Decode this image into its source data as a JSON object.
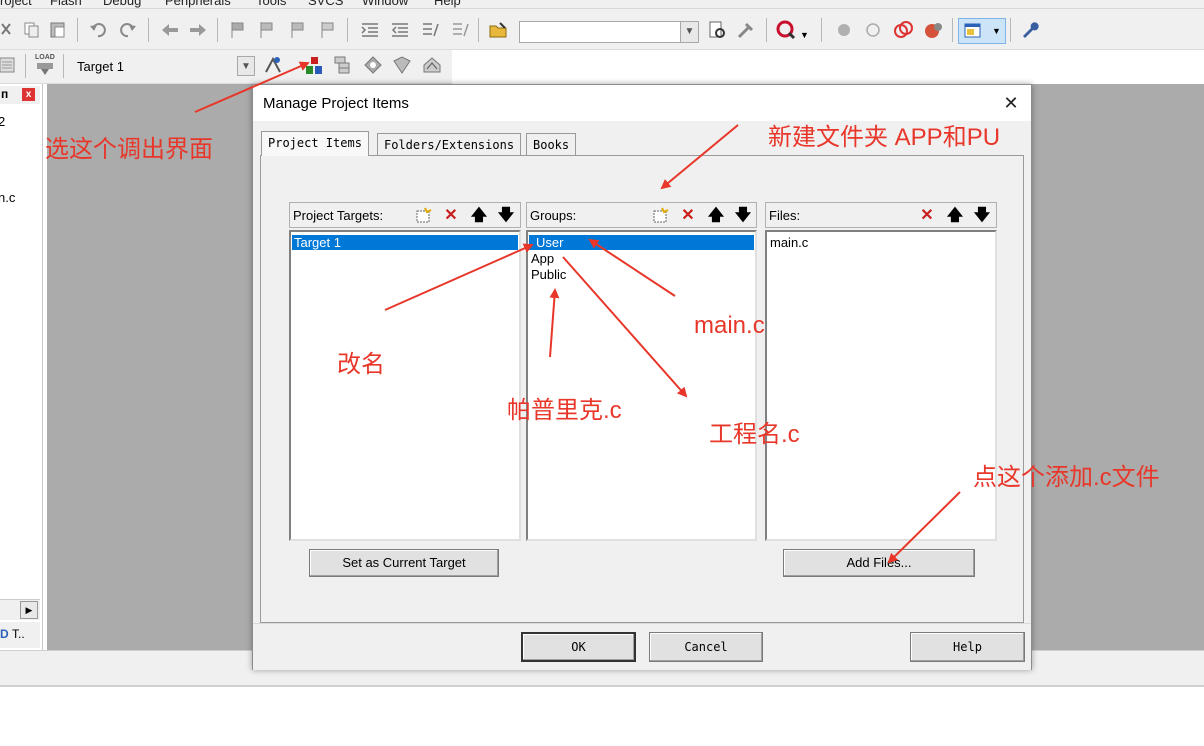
{
  "menu": {
    "items": [
      "roject",
      "Flash",
      "Debug",
      "Peripherals",
      "Tools",
      "SVCS",
      "Window",
      "Help"
    ]
  },
  "toolbar2": {
    "target_combo_value": "Target 1",
    "load_label": "LOAD"
  },
  "left_panel": {
    "line1": "2",
    "line2": "n.c",
    "bottom_tab": "T.."
  },
  "dialog": {
    "title": "Manage Project Items",
    "close_glyph": "✕",
    "tabs": [
      "Project Items",
      "Folders/Extensions",
      "Books"
    ],
    "targets": {
      "label": "Project Targets:",
      "items": [
        "Target 1"
      ],
      "selected_index": 0
    },
    "groups": {
      "label": "Groups:",
      "items": [
        "User",
        "App",
        "Public"
      ],
      "selected_index": 0
    },
    "files": {
      "label": "Files:",
      "items": [
        "main.c"
      ]
    },
    "buttons": {
      "set_current": "Set as Current Target",
      "add_files": "Add Files...",
      "ok": "OK",
      "cancel": "Cancel",
      "help": "Help"
    }
  },
  "annotations": {
    "select_ui": "选这个调出界面",
    "new_folder": "新建文件夹 APP和PU",
    "rename": "改名",
    "main_c": "main.c",
    "pupuli": "帕普里克.c",
    "project_name": "工程名.c",
    "add_c_file": "点这个添加.c文件"
  },
  "colors": {
    "annotation": "#e8372a",
    "selection": "#0078d7",
    "workspace": "#ababab"
  }
}
